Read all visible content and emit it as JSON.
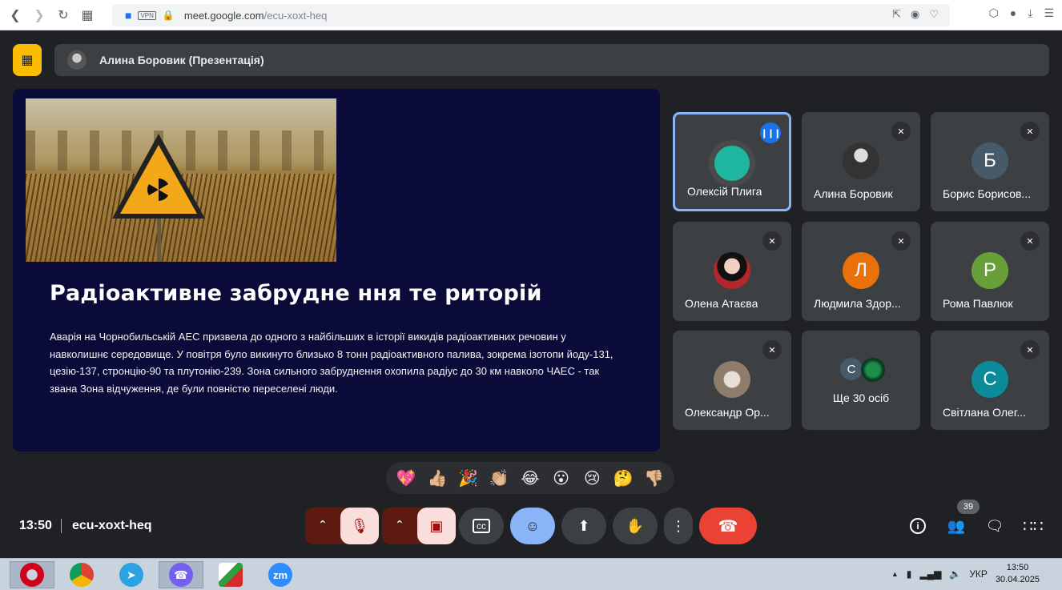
{
  "browser": {
    "url_domain": "meet.google.com",
    "url_path": "/ecu-xoxt-heq",
    "vpn_label": "VPN"
  },
  "presenter_bar": {
    "label": "Алина Боровик (Презентація)"
  },
  "slide": {
    "title": "Радіоактивне забрудне ння те риторій",
    "body": "Аварія на Чорнобильській АЕС призвела до одного з найбільших в історії викидів радіоактивних речовин у навколишнє середовище. У повітря було викинуто близько 8 тонн радіоактивного палива, зокрема ізотопи йоду-131, цезію-137, стронцію-90 та плутонію-239. Зона сильного забруднення охопила радіус до 30 км навколо ЧАЕС - так звана Зона відчуження, де були повністю переселені люди."
  },
  "participants": [
    {
      "name": "Олексій Плига",
      "initial": "",
      "speaking": true,
      "color": "#1fb7a0"
    },
    {
      "name": "Алина Боровик",
      "initial": "",
      "speaking": false,
      "color": "#888888"
    },
    {
      "name": "Борис Борисов...",
      "initial": "Б",
      "speaking": false,
      "color": "#465a69"
    },
    {
      "name": "Олена Атаєва",
      "initial": "",
      "speaking": false,
      "color": "#b3262a"
    },
    {
      "name": "Людмила Здор...",
      "initial": "Л",
      "speaking": false,
      "color": "#e8710a"
    },
    {
      "name": "Рома Павлюк",
      "initial": "Р",
      "speaking": false,
      "color": "#689f38"
    },
    {
      "name": "Олександр Ор...",
      "initial": "",
      "speaking": false,
      "color": "#8d7d6a"
    },
    {
      "name": "Світлана Олег...",
      "initial": "С",
      "speaking": false,
      "color": "#0b8a9a"
    }
  ],
  "more": {
    "label": "Ще 30 осіб",
    "initial": "С"
  },
  "reactions": [
    "💖",
    "👍🏼",
    "🎉",
    "👏🏼",
    "😂",
    "😮",
    "😢",
    "🤔",
    "👎🏼"
  ],
  "footer": {
    "time": "13:50",
    "meeting_code": "ecu-xoxt-heq",
    "people_count": "39"
  },
  "taskbar": {
    "lang": "УКР",
    "time": "13:50",
    "date": "30.04.2025",
    "zoom_label": "zm"
  },
  "colors": {
    "accent": "#8ab4f8",
    "end_call": "#ea4335",
    "present_icon": "#fbbc04"
  }
}
